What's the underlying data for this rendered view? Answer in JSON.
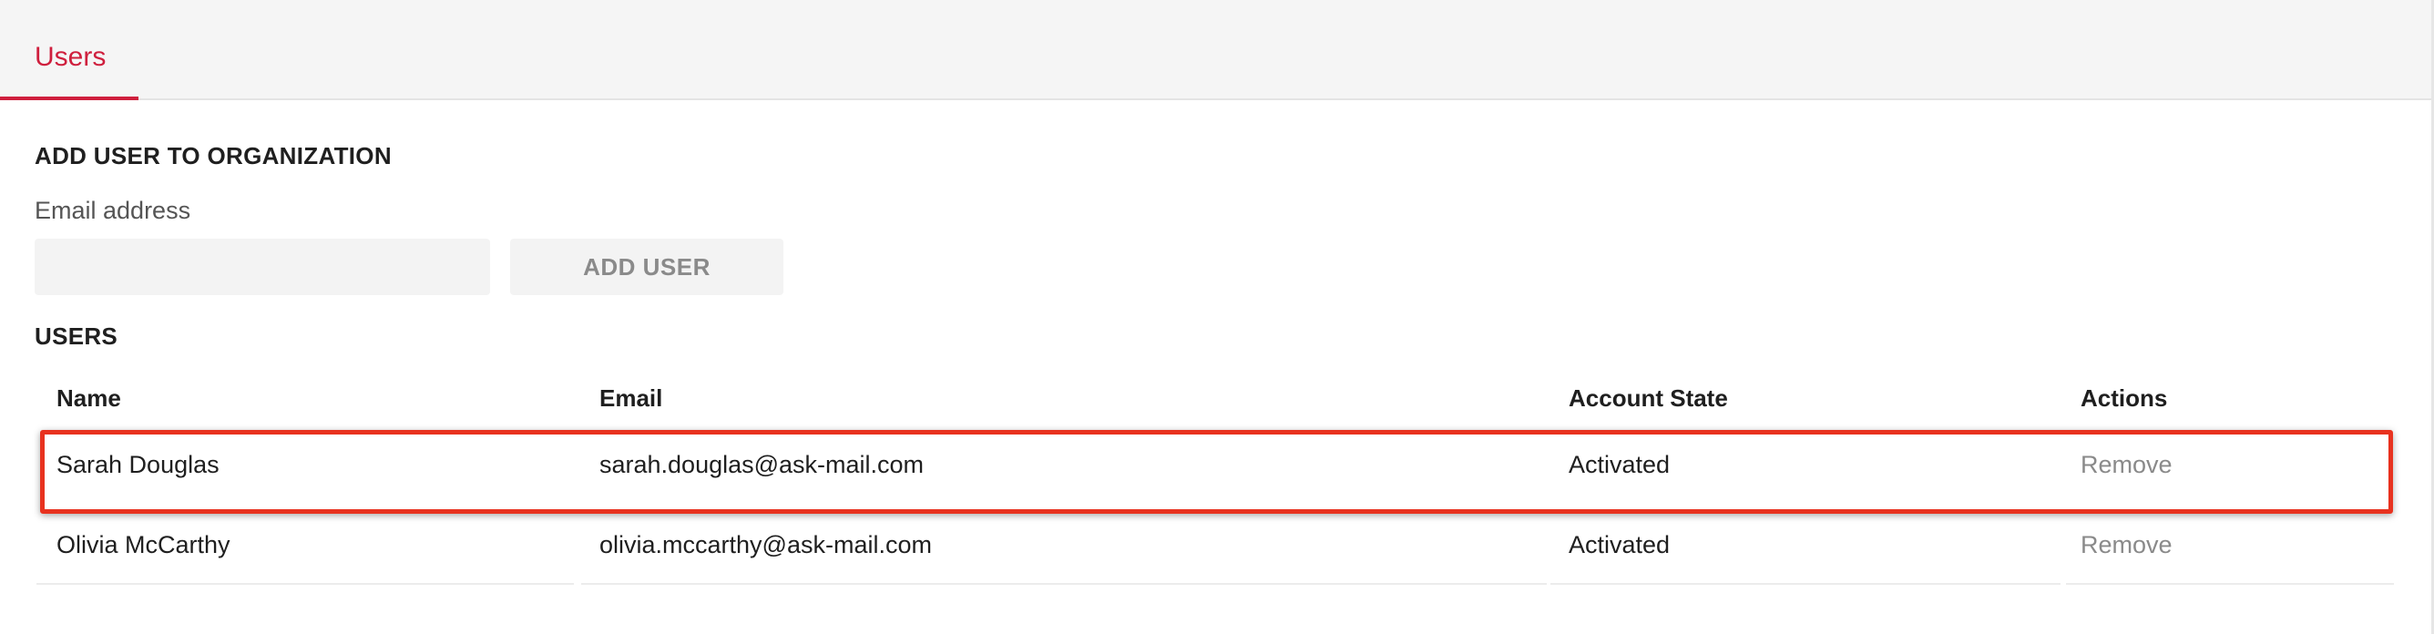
{
  "tabs": [
    {
      "label": "Users",
      "active": true
    }
  ],
  "add_user": {
    "title": "ADD USER TO ORGANIZATION",
    "email_label": "Email address",
    "email_value": "",
    "button_label": "ADD USER"
  },
  "users": {
    "title": "USERS",
    "columns": [
      "Name",
      "Email",
      "Account State",
      "Actions"
    ],
    "rows": [
      {
        "name": "Sarah Douglas",
        "email": "sarah.douglas@ask-mail.com",
        "state": "Activated",
        "action": "Remove"
      },
      {
        "name": "Olivia McCarthy",
        "email": "olivia.mccarthy@ask-mail.com",
        "state": "Activated",
        "action": "Remove"
      }
    ]
  },
  "colors": {
    "accent": "#cf1f3d",
    "highlight": "#e8321f"
  }
}
